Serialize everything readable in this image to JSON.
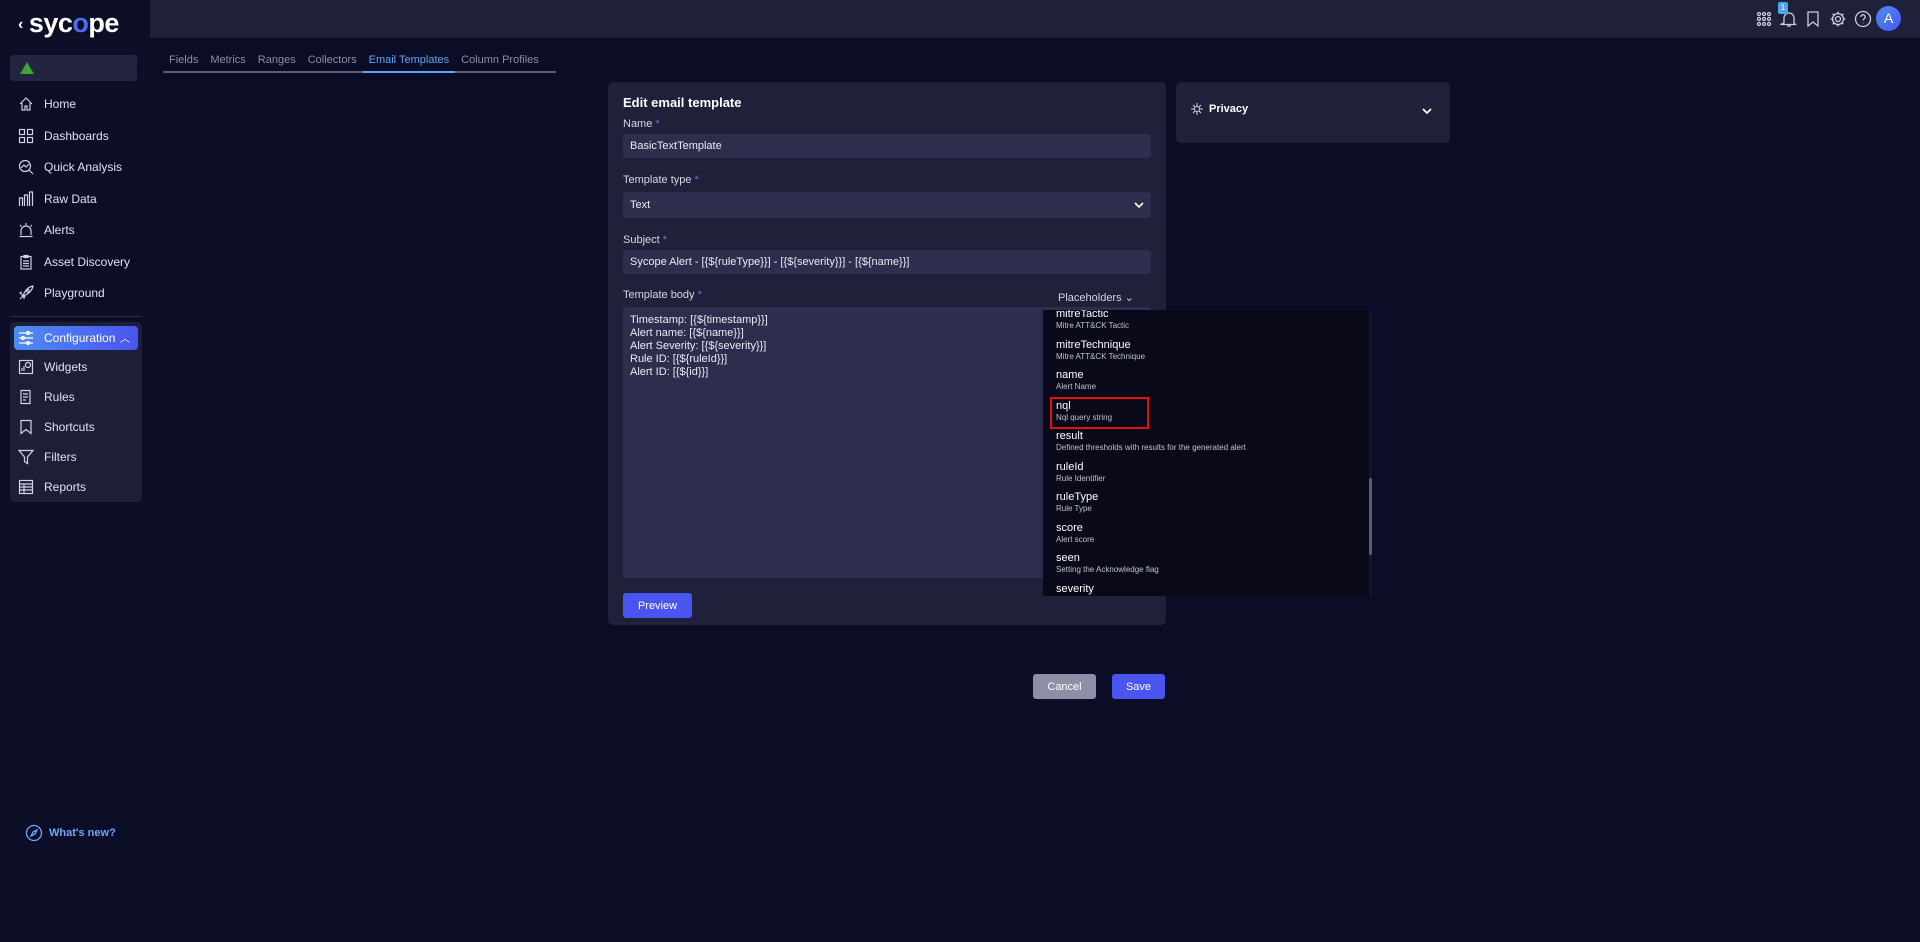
{
  "brand": {
    "logo_text_a": "syc",
    "logo_text_o": "o",
    "logo_text_b": "pe",
    "back": "‹"
  },
  "sidebar": {
    "items": [
      {
        "label": "Home",
        "icon": "home-icon"
      },
      {
        "label": "Dashboards",
        "icon": "dashboard-icon"
      },
      {
        "label": "Quick Analysis",
        "icon": "quick-analysis-icon"
      },
      {
        "label": "Raw Data",
        "icon": "raw-data-icon"
      },
      {
        "label": "Alerts",
        "icon": "alert-icon"
      },
      {
        "label": "Asset Discovery",
        "icon": "clipboard-icon"
      },
      {
        "label": "Playground",
        "icon": "rocket-icon"
      }
    ],
    "configuration": {
      "label": "Configuration",
      "items": [
        {
          "label": "Widgets"
        },
        {
          "label": "Rules"
        },
        {
          "label": "Shortcuts"
        },
        {
          "label": "Filters"
        },
        {
          "label": "Reports"
        }
      ]
    },
    "whats_new": "What's new?",
    "tenant_status_color": "#3fa53b"
  },
  "header": {
    "notification_count": "1",
    "avatar": "A"
  },
  "tabs": [
    {
      "label": "Fields"
    },
    {
      "label": "Metrics"
    },
    {
      "label": "Ranges"
    },
    {
      "label": "Collectors"
    },
    {
      "label": "Email Templates",
      "active": true
    },
    {
      "label": "Column Profiles"
    }
  ],
  "form": {
    "title": "Edit email template",
    "name_label": "Name",
    "name_value": "BasicTextTemplate",
    "type_label": "Template type",
    "type_value": "Text",
    "subject_label": "Subject",
    "subject_value": "Sycope Alert - [{${ruleType}}] - [{${severity}}] - [{${name}}]",
    "body_label": "Template body",
    "required": "*",
    "placeholders_label": "Placeholders",
    "body_value": "Timestamp: [{${timestamp}}]\nAlert name: [{${name}}]\nAlert Severity: [{${severity}}]\nRule ID: [{${ruleId}}]\nAlert ID: [{${id}}]",
    "preview": "Preview"
  },
  "placeholders": [
    {
      "name": "mitreTactic",
      "desc": "Mitre ATT&CK Tactic"
    },
    {
      "name": "mitreTechnique",
      "desc": "Mitre ATT&CK Technique"
    },
    {
      "name": "name",
      "desc": "Alert Name"
    },
    {
      "name": "nql",
      "desc": "Nql query string",
      "highlighted": true
    },
    {
      "name": "result",
      "desc": "Defined thresholds with results for the generated alert"
    },
    {
      "name": "ruleId",
      "desc": "Rule Identifier"
    },
    {
      "name": "ruleType",
      "desc": "Rule Type"
    },
    {
      "name": "score",
      "desc": "Alert score"
    },
    {
      "name": "seen",
      "desc": "Setting the Acknowledge flag"
    },
    {
      "name": "severity",
      "desc": ""
    }
  ],
  "actions": {
    "cancel": "Cancel",
    "save": "Save"
  },
  "privacy": {
    "label": "Privacy"
  },
  "colors": {
    "accent": "#4a55f0",
    "active_tab": "#5ba6f5",
    "highlight": "#e01010"
  }
}
